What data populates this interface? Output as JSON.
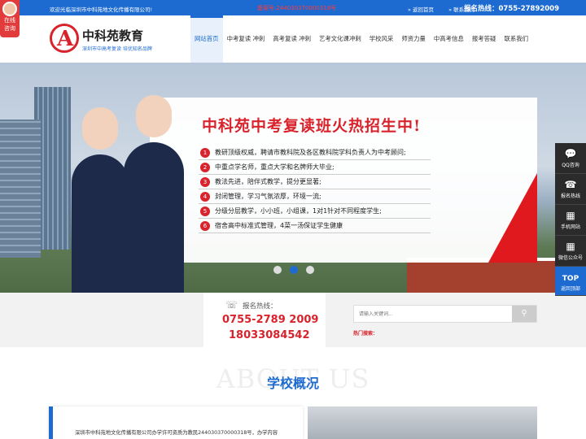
{
  "topbar": {
    "welcome": "欢迎光临深圳市中科苑地文化传播有限公司!",
    "record": "备案号:244030370000318号",
    "links": [
      "返回首页",
      "联系我们"
    ],
    "hotline_label": "报名热线：",
    "hotline_number": "0755-27892009"
  },
  "online_tab": {
    "line1": "在线",
    "line2": "咨询"
  },
  "logo": {
    "mark": "A",
    "name": "中科苑教育",
    "slogan": "深圳市中高考复读 培优知名品牌"
  },
  "nav": [
    {
      "label": "网站首页",
      "active": true
    },
    {
      "label": "中考复读 冲刺"
    },
    {
      "label": "高考复读 冲刺"
    },
    {
      "label": "艺考文化课冲刺"
    },
    {
      "label": "学校风采"
    },
    {
      "label": "师资力量"
    },
    {
      "label": "中高考信息"
    },
    {
      "label": "报考答疑"
    },
    {
      "label": "联系我们"
    }
  ],
  "banner": {
    "title": "中科苑中考复读班火热招生中!",
    "points": [
      {
        "n": "1",
        "text": "教研顶级权威，聘请市教科院及各区教科院学科负责人为中考顾问;"
      },
      {
        "n": "2",
        "text": "中重点学名师，重点大学和名牌师大毕业;"
      },
      {
        "n": "3",
        "text": "教法先进，陪伴式教学，提分更显著;"
      },
      {
        "n": "4",
        "text": "封闭管理，学习气氛浓厚，环境一流;"
      },
      {
        "n": "5",
        "text": "分级分层教学，小小班，小组课，1对1针对不同程度学生;"
      },
      {
        "n": "6",
        "text": "宿舍高中标准式管理，4菜一汤保证学生健康"
      }
    ],
    "slides": 3,
    "active_slide": 1
  },
  "side_tools": [
    {
      "icon": "💬",
      "label": "QQ咨询"
    },
    {
      "icon": "☎",
      "label": "报名热线"
    },
    {
      "icon": "▦",
      "label": "手机网站"
    },
    {
      "icon": "▦",
      "label": "微信公众号"
    }
  ],
  "side_top": {
    "icon": "TOP",
    "label": "返回顶部"
  },
  "hotline": {
    "label": "报名热线：",
    "phone1": "0755-2789 2009",
    "phone2": "18033084542"
  },
  "search": {
    "placeholder": "请输入关键词...",
    "hot_label": "热门搜索："
  },
  "about": {
    "en": "ABOUT US",
    "cn": "学校概况",
    "text": "深圳市中科苑地文化传播有限公司办学许可资质为教民244030370000318号，办学内容"
  },
  "colors": {
    "brand": "#1d6bd1",
    "accent": "#d9232c"
  }
}
